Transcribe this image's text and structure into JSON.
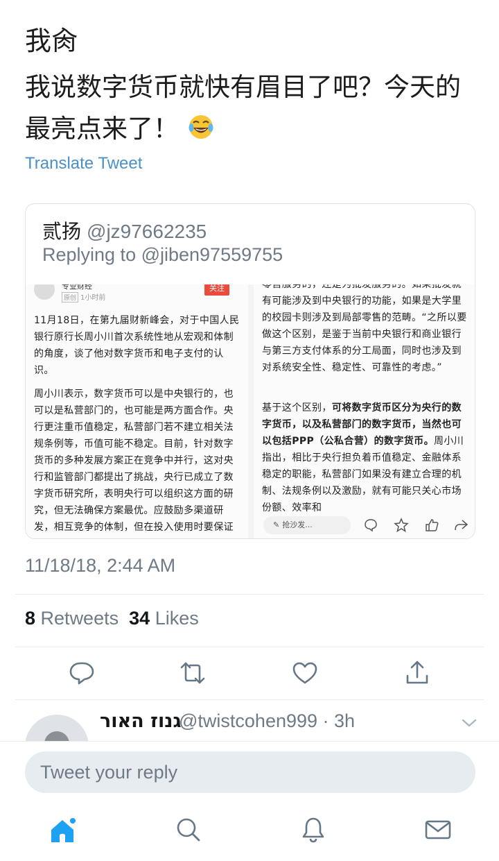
{
  "tweet": {
    "author": "我肏",
    "text": "我说数字货币就快有眉目了吧？今天的最亮点来了！",
    "emoji": "laughing-tears-emoji",
    "translate_label": "Translate Tweet",
    "timestamp": "11/18/18, 2:44 AM",
    "retweets_count": "8",
    "retweets_label": "Retweets",
    "likes_count": "34",
    "likes_label": "Likes"
  },
  "quoted": {
    "name": "贰扬",
    "handle": "@jz97662235",
    "replying_to": "Replying to @jiben97559755",
    "left_image": {
      "source": "专业财经",
      "tag": "原创",
      "time": "1小时前",
      "follow": "关注",
      "para1": "11月18日，在第九届财新峰会，对于中国人民银行原行长周小川首次系统性地从宏观和体制的角度，谈了他对数字货币和电子支付的认识。",
      "para2": "周小川表示，数字货币可以是中央银行的，也可以是私营部门的，也可能是两方面合作。央行更注重币值稳定，私营部门若不建立相关法规条例等，币值可能不稳定。目前，针对数字货币的多种发展方案正在竞争中并行，这对央行和监管部门都提出了挑战，央行已成立了数字货币研究所，表明央行可以组织这方面的研究，但无法确保方案最优。应鼓励多渠道研发，相互竞争的体制，但在投入使用时要保证"
    },
    "right_image": {
      "para1": "零售服务的，还是为批发服务的。如果批发就有可能涉及到中央银行的功能，如果是大学里的校园卡则涉及到局部零售的范畴。“之所以要做这个区别，是鉴于当前中央银行和商业银行与第三方支付体系的分工局面，同时也涉及到对系统安全性、稳定性、可靠性的考虑。”",
      "para2_lead": "基于这个区别，",
      "para2_bold": "可将数字货币区分为央行的数字货币，以及私营部门的数字货币，当然也可以包括PPP（公私合营）的数字货币。",
      "para2_rest": "周小川指出，相比于央行担负着币值稳定、金融体系稳定的职能，私营部门如果没有建立合理的机制、法规条例以及激励，就有可能只关心市场份额、效率和",
      "comment_placeholder": "抢沙发..."
    }
  },
  "reply": {
    "name": "גנוז האור",
    "handle": "@twistcohen999 · 3h"
  },
  "compose": {
    "placeholder": "Tweet your reply"
  },
  "colors": {
    "accent": "#1da1f2",
    "muted": "#6e7a86",
    "link": "#4a90c8"
  }
}
